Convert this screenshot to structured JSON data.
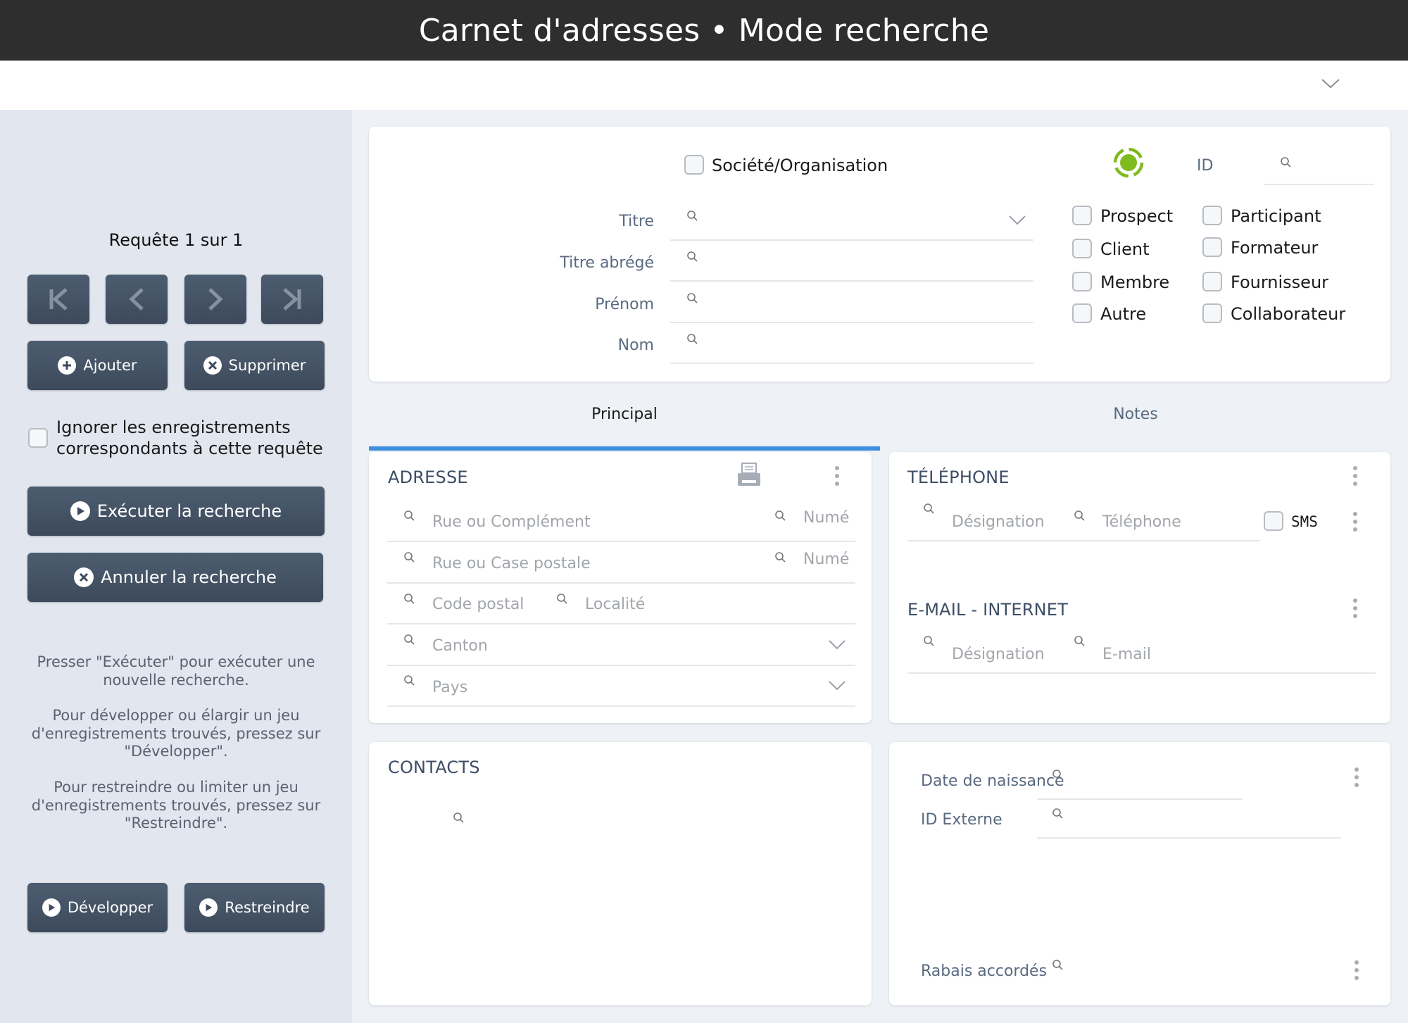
{
  "header": {
    "title": "Carnet d'adresses • Mode recherche"
  },
  "toolbar": {
    "expand_icon": "chevron-down-icon"
  },
  "sidebar": {
    "request_counter": "Requête 1 sur 1",
    "nav_buttons": [
      {
        "name": "first-record",
        "icon": "first-icon"
      },
      {
        "name": "previous-record",
        "icon": "previous-icon"
      },
      {
        "name": "next-record",
        "icon": "next-icon"
      },
      {
        "name": "last-record",
        "icon": "last-icon"
      }
    ],
    "add_label": "Ajouter",
    "delete_label": "Supprimer",
    "ignore_checkbox": {
      "label_line1": "Ignorer les enregistrements",
      "label_line2": "correspondants à cette requête",
      "checked": false
    },
    "execute_label": "Exécuter la recherche",
    "cancel_label": "Annuler la recherche",
    "help": [
      "Presser \"Exécuter\" pour exécuter une nouvelle recherche.",
      "Pour développer ou élargir un jeu d'enregistrements trouvés, pressez sur \"Développer\".",
      "Pour restreindre ou limiter un jeu d'enregistrements trouvés, pressez sur \"Restreindre\"."
    ],
    "develop_label": "Développer",
    "restrict_label": "Restreindre"
  },
  "identity": {
    "org_checkbox": {
      "label": "Société/Organisation",
      "checked": false
    },
    "status_color": "#7fba1f",
    "id_label": "ID",
    "id_value": "",
    "fields": [
      {
        "label": "Titre",
        "value": "",
        "dropdown": true
      },
      {
        "label": "Titre abrégé",
        "value": ""
      },
      {
        "label": "Prénom",
        "value": ""
      },
      {
        "label": "Nom",
        "value": ""
      }
    ],
    "categories_left": [
      {
        "label": "Prospect",
        "checked": false
      },
      {
        "label": "Client",
        "checked": false
      },
      {
        "label": "Membre",
        "checked": false
      },
      {
        "label": "Autre",
        "checked": false
      }
    ],
    "categories_right": [
      {
        "label": "Participant",
        "checked": false
      },
      {
        "label": "Formateur",
        "checked": false
      },
      {
        "label": "Fournisseur",
        "checked": false
      },
      {
        "label": "Collaborateur",
        "checked": false
      }
    ]
  },
  "tabs": [
    {
      "label": "Principal",
      "active": true
    },
    {
      "label": "Notes",
      "active": false
    }
  ],
  "accent_color": "#3d8fe0",
  "address": {
    "title": "ADRESSE",
    "street1_placeholder": "Rue ou Complément",
    "number1_placeholder": "Numé",
    "street2_placeholder": "Rue ou Case postale",
    "number2_placeholder": "Numé",
    "zip_placeholder": "Code postal",
    "city_placeholder": "Localité",
    "canton_placeholder": "Canton",
    "country_placeholder": "Pays"
  },
  "phone": {
    "title": "TÉLÉPHONE",
    "designation_placeholder": "Désignation",
    "phone_placeholder": "Téléphone",
    "sms_label": "SMS",
    "sms_checked": false
  },
  "email": {
    "title": "E-MAIL - INTERNET",
    "designation_placeholder": "Désignation",
    "email_placeholder": "E-mail"
  },
  "contacts": {
    "title": "CONTACTS"
  },
  "extra": {
    "birthdate_label": "Date de naissance",
    "external_id_label": "ID Externe",
    "discounts_label": "Rabais accordés"
  }
}
